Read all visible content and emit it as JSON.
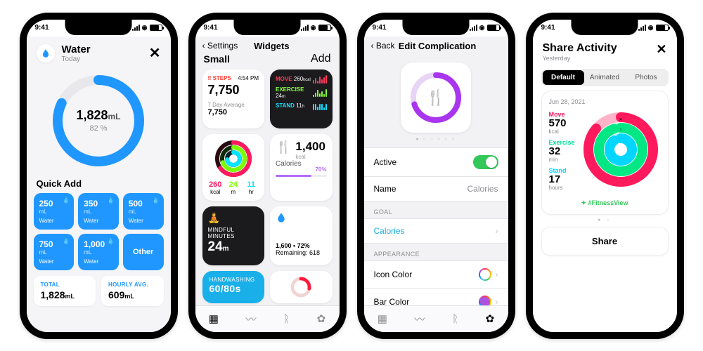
{
  "status_time": "9:41",
  "phone1": {
    "title": "Water",
    "subtitle": "Today",
    "amount": "1,828",
    "unit": "mL",
    "percent": "82 %",
    "quick_add_label": "Quick Add",
    "buttons": [
      {
        "v": "250",
        "u": "mL",
        "l": "Water"
      },
      {
        "v": "350",
        "u": "mL",
        "l": "Water"
      },
      {
        "v": "500",
        "u": "mL",
        "l": "Water"
      },
      {
        "v": "750",
        "u": "mL",
        "l": "Water"
      },
      {
        "v": "1,000",
        "u": "mL",
        "l": "Water"
      },
      {
        "v": "",
        "u": "",
        "l": "Other"
      }
    ],
    "total": {
      "l": "TOTAL",
      "v": "1,828",
      "u": "mL"
    },
    "hourly": {
      "l": "HOURLY AVG.",
      "v": "609",
      "u": "mL"
    }
  },
  "phone2": {
    "back": "Settings",
    "title": "Widgets",
    "section": "Small",
    "add": "Add",
    "steps": {
      "label": "STEPS",
      "time": "4:54 PM",
      "value": "7,750",
      "avg_l": "7 Day Average",
      "avg": "7,750"
    },
    "move": {
      "move_l": "MOVE",
      "move_v": "260",
      "move_u": "kcal",
      "ex_l": "EXERCISE",
      "ex_v": "24",
      "ex_u": "m",
      "st_l": "STAND",
      "st_v": "11",
      "st_u": "h"
    },
    "rings": {
      "m": "260",
      "m_u": "kcal",
      "e": "24",
      "e_u": "m",
      "s": "11",
      "s_u": "hr"
    },
    "cals": {
      "value": "1,400",
      "unit": "kcal",
      "label": "Calories",
      "pct": "70%"
    },
    "mind": {
      "label": "MINDFUL MINUTES",
      "value": "24",
      "unit": "m"
    },
    "water": {
      "line1": "1,600 • 72%",
      "line2": "Remaining: 618"
    },
    "hand": {
      "label": "HANDWASHING",
      "value": "60/80s"
    }
  },
  "phone3": {
    "back": "Back",
    "title": "Edit Complication",
    "active_l": "Active",
    "name_l": "Name",
    "name_v": "Calories",
    "goal_section": "GOAL",
    "goal_l": "Calories",
    "app_section": "APPEARANCE",
    "icon_l": "Icon Color",
    "bar_l": "Bar Color"
  },
  "phone4": {
    "title": "Share Activity",
    "subtitle": "Yesterday",
    "tabs": [
      "Default",
      "Animated",
      "Photos"
    ],
    "date": "Jun 28, 2021",
    "move": {
      "l": "Move",
      "v": "570",
      "u": "kcal"
    },
    "ex": {
      "l": "Exercise",
      "v": "32",
      "u": "min"
    },
    "stand": {
      "l": "Stand",
      "v": "17",
      "u": "hours"
    },
    "hashtag": "#FitnessView",
    "share": "Share"
  }
}
